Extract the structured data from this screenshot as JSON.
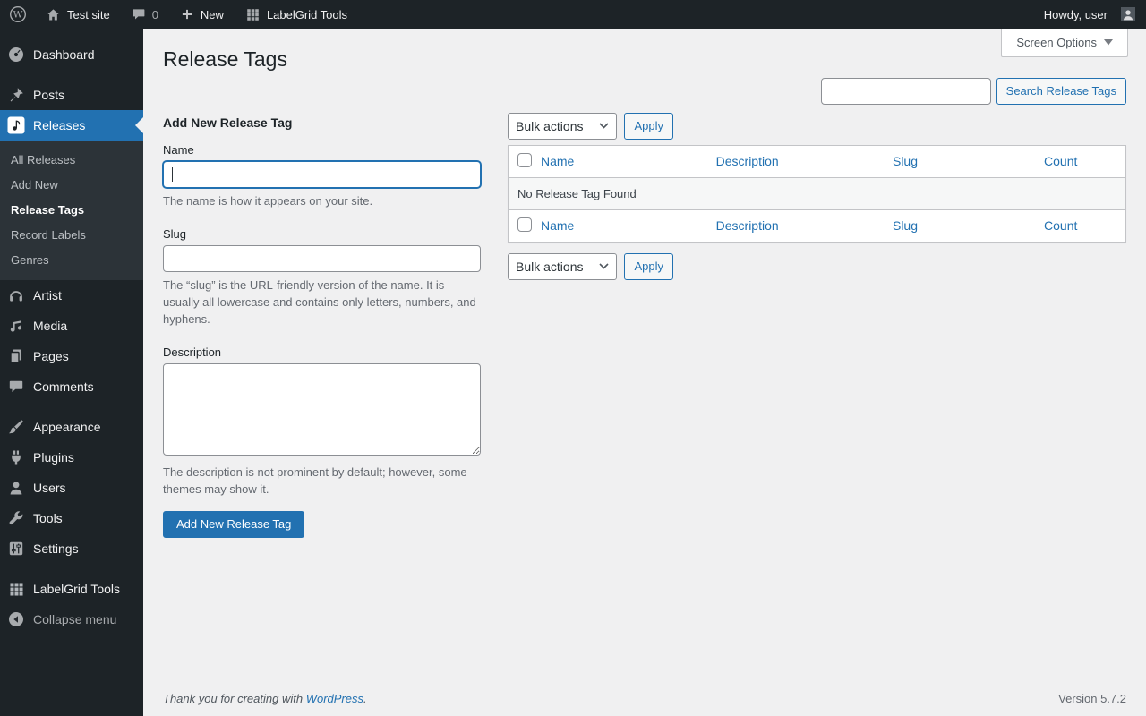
{
  "admin_bar": {
    "site_name": "Test site",
    "comment_count": "0",
    "new_label": "New",
    "labelgrid_label": "LabelGrid Tools",
    "howdy_label": "Howdy, user"
  },
  "sidebar": {
    "items": [
      {
        "label": "Dashboard"
      },
      {
        "label": "Posts"
      },
      {
        "label": "Releases"
      },
      {
        "label": "Artist"
      },
      {
        "label": "Media"
      },
      {
        "label": "Pages"
      },
      {
        "label": "Comments"
      },
      {
        "label": "Appearance"
      },
      {
        "label": "Plugins"
      },
      {
        "label": "Users"
      },
      {
        "label": "Tools"
      },
      {
        "label": "Settings"
      },
      {
        "label": "LabelGrid Tools"
      }
    ],
    "releases_submenu": [
      {
        "label": "All Releases"
      },
      {
        "label": "Add New"
      },
      {
        "label": "Release Tags"
      },
      {
        "label": "Record Labels"
      },
      {
        "label": "Genres"
      }
    ],
    "collapse_label": "Collapse menu"
  },
  "page": {
    "title": "Release Tags",
    "screen_options_label": "Screen Options",
    "search_button_label": "Search Release Tags",
    "search_value": ""
  },
  "form": {
    "heading": "Add New Release Tag",
    "name_label": "Name",
    "name_value": "",
    "name_help": "The name is how it appears on your site.",
    "slug_label": "Slug",
    "slug_value": "",
    "slug_help": "The “slug” is the URL-friendly version of the name. It is usually all lowercase and contains only letters, numbers, and hyphens.",
    "description_label": "Description",
    "description_value": "",
    "description_help": "The description is not prominent by default; however, some themes may show it.",
    "submit_label": "Add New Release Tag"
  },
  "list": {
    "bulk_actions_label": "Bulk actions",
    "apply_label": "Apply",
    "columns": [
      {
        "label": "Name"
      },
      {
        "label": "Description"
      },
      {
        "label": "Slug"
      },
      {
        "label": "Count"
      }
    ],
    "empty_message": "No Release Tag Found"
  },
  "footer": {
    "thanks_prefix": "Thank you for creating with ",
    "wordpress_link_label": "WordPress",
    "thanks_suffix": ".",
    "version": "Version 5.7.2"
  },
  "colors": {
    "accent": "#2271b1",
    "admin_bar_bg": "#1d2327",
    "sidebar_bg": "#1d2327",
    "submenu_bg": "#2c3338",
    "content_bg": "#f0f0f1",
    "table_border": "#c3c4c7",
    "muted_text": "#646970"
  }
}
